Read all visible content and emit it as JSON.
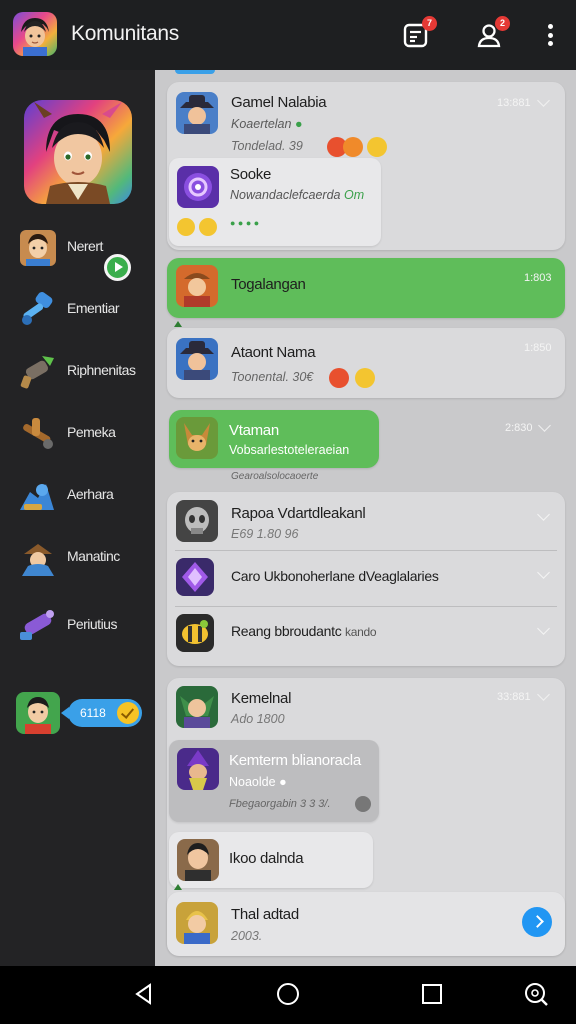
{
  "header": {
    "title": "Komunitans",
    "left_avatar_icon": "user-avatar-icon",
    "actions": [
      {
        "icon": "clipboard-icon",
        "badge": "7"
      },
      {
        "icon": "friends-icon",
        "badge": "2"
      },
      {
        "icon": "more-vertical-icon"
      }
    ]
  },
  "sidebar": {
    "profile_icon": "profile-hero-avatar",
    "items": [
      {
        "label": "Nerert",
        "icon": "person-avatar-icon"
      },
      {
        "label": "Ementiar",
        "icon": "hammer-icon"
      },
      {
        "label": "Riphnenitas",
        "icon": "blaster-icon"
      },
      {
        "label": "Pemeka",
        "icon": "crossbow-icon"
      },
      {
        "label": "Aerhara",
        "icon": "dragon-icon"
      },
      {
        "label": "Manatinc",
        "icon": "ranger-icon"
      },
      {
        "label": "Periutius",
        "icon": "cannon-icon"
      }
    ],
    "promo": {
      "text": "6118",
      "icon": "check-icon"
    }
  },
  "feed": {
    "messages": [
      {
        "name": "Gamel Nalabia",
        "sub": "Koaertelan",
        "time": "13:881",
        "sub2": "Tondelad. 39"
      },
      {
        "name": "Sooke",
        "sub": "Nowandaclefcaerda",
        "sub_tag": "Om",
        "dots": "● ● ● ●"
      },
      {
        "name": "Togalangan",
        "time": "1:803"
      },
      {
        "name": "Ataont Nama",
        "sub": "Toonental. 30€",
        "time": "1:850"
      },
      {
        "name": "Vtaman",
        "sub": "Vobsarlestoteleraeian",
        "time": "2:830",
        "footer": "Gearoalsolocaoerte"
      },
      {
        "name": "Rapoa Vdartdleakanl",
        "sub": "E69 1.80 96"
      },
      {
        "name": "Caro Ukbonoherlane dVeaglalaries"
      },
      {
        "name": "Reang bbroudantc",
        "sub_inline": "kando"
      },
      {
        "name": "Kemelnal",
        "sub": "Ado 1800",
        "time": "33:881"
      },
      {
        "name": "Kemterm blianoracla",
        "sub": "Noaolde",
        "footer": "Fbegaorgabin 3 3 3/."
      },
      {
        "name": "Ikoo dalnda"
      },
      {
        "name": "Thal adtad",
        "sub": "2003."
      }
    ]
  },
  "navbar": {
    "icons": [
      "back-icon",
      "home-icon",
      "recents-icon",
      "search-icon"
    ]
  }
}
